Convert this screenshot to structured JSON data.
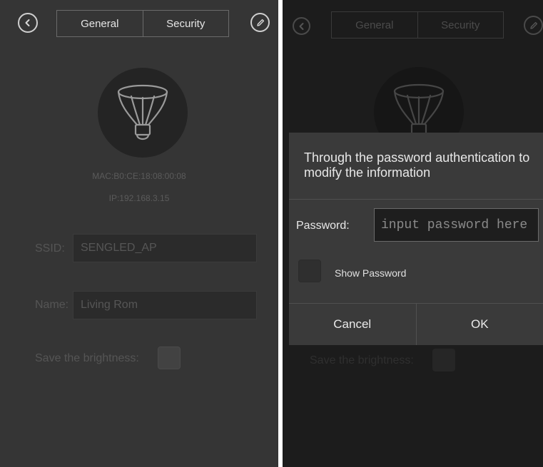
{
  "left_screen": {
    "tabs": [
      "General",
      "Security"
    ],
    "mac": "MAC:B0:CE:18:08:00:08",
    "ip": "IP:192.168.3.15",
    "ssid_label": "SSID:",
    "ssid_value": "SENGLED_AP",
    "name_label": "Name:",
    "name_value": "Living Rom",
    "brightness_label": "Save the brightness:"
  },
  "right_screen": {
    "tabs": [
      "General",
      "Security"
    ],
    "brightness_label": "Save the brightness:",
    "dialog": {
      "title": "Through the password authentication to modify the information",
      "password_label": "Password:",
      "password_placeholder": "input password here",
      "show_password_label": "Show Password",
      "cancel_label": "Cancel",
      "ok_label": "OK"
    }
  },
  "icons": [
    "back-icon",
    "edit-icon",
    "lightbulb-icon"
  ],
  "colors": {
    "left_background": "#353535",
    "right_background": "#1c1c1c",
    "dialog_background": "#3a3a3a"
  }
}
